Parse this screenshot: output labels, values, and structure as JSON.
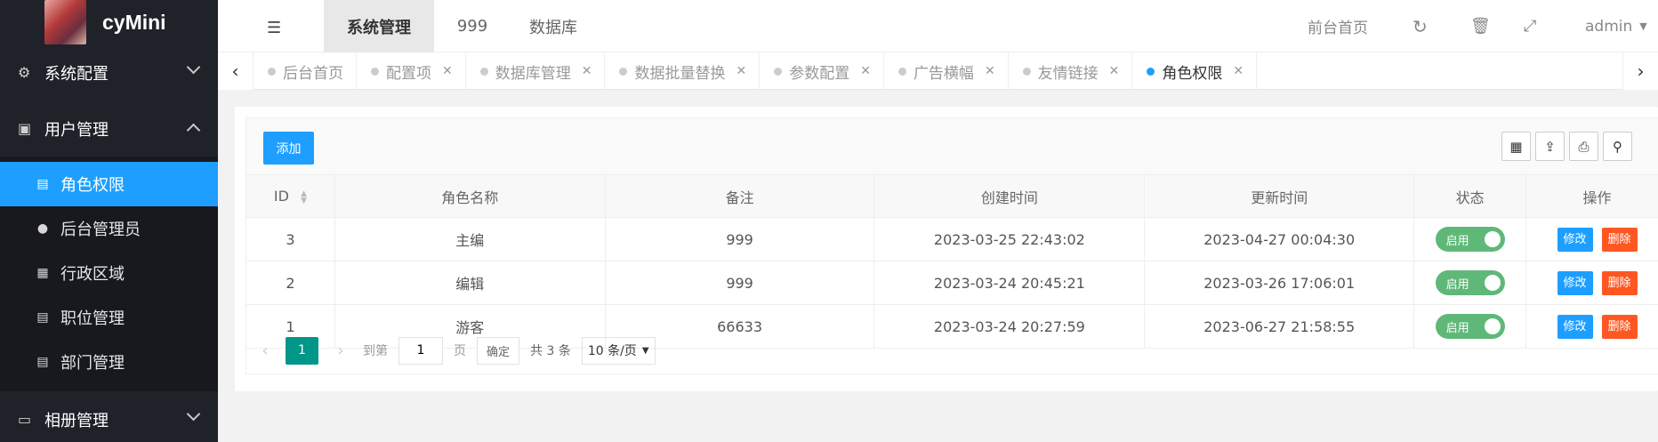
{
  "app": {
    "title": "cyMini"
  },
  "sidebar": {
    "groups": [
      {
        "label": "系统配置",
        "icon": "gears-icon",
        "expanded": false
      },
      {
        "label": "用户管理",
        "icon": "user-card-icon",
        "expanded": true
      },
      {
        "label": "相册管理",
        "icon": "folder-icon",
        "expanded": false
      }
    ],
    "user_items": [
      {
        "label": "角色权限",
        "icon": "id-card-icon",
        "active": true
      },
      {
        "label": "后台管理员",
        "icon": "users-icon",
        "active": false
      },
      {
        "label": "行政区域",
        "icon": "grid-icon",
        "active": false
      },
      {
        "label": "职位管理",
        "icon": "id-card-icon",
        "active": false
      },
      {
        "label": "部门管理",
        "icon": "id-card-icon",
        "active": false
      }
    ]
  },
  "header": {
    "menu_icon": "hamburger-icon",
    "tabs": [
      {
        "label": "系统管理",
        "active": true
      },
      {
        "label": "999",
        "active": false
      },
      {
        "label": "数据库",
        "active": false
      }
    ],
    "front_home": "前台首页",
    "user": "admin"
  },
  "page_tabs": [
    {
      "label": "后台首页",
      "closable": false,
      "active": false
    },
    {
      "label": "配置项",
      "closable": true,
      "active": false
    },
    {
      "label": "数据库管理",
      "closable": true,
      "active": false
    },
    {
      "label": "数据批量替换",
      "closable": true,
      "active": false
    },
    {
      "label": "参数配置",
      "closable": true,
      "active": false
    },
    {
      "label": "广告横幅",
      "closable": true,
      "active": false
    },
    {
      "label": "友情链接",
      "closable": true,
      "active": false
    },
    {
      "label": "角色权限",
      "closable": true,
      "active": true
    }
  ],
  "toolbar": {
    "add_label": "添加"
  },
  "table": {
    "columns": [
      "ID",
      "角色名称",
      "备注",
      "创建时间",
      "更新时间",
      "状态",
      "操作"
    ],
    "rows": [
      {
        "id": "3",
        "name": "主编",
        "remark": "999",
        "created": "2023-03-25 22:43:02",
        "updated": "2023-04-27 00:04:30",
        "status": "启用"
      },
      {
        "id": "2",
        "name": "编辑",
        "remark": "999",
        "created": "2023-03-24 20:45:21",
        "updated": "2023-03-26 17:06:01",
        "status": "启用"
      },
      {
        "id": "1",
        "name": "游客",
        "remark": "66633",
        "created": "2023-03-24 20:27:59",
        "updated": "2023-06-27 21:58:55",
        "status": "启用"
      }
    ],
    "edit_label": "修改",
    "delete_label": "删除"
  },
  "pager": {
    "current": "1",
    "goto_label": "到第",
    "goto_value": "1",
    "page_unit": "页",
    "confirm_label": "确定",
    "total_label": "共 3 条",
    "page_size": "10 条/页"
  },
  "colors": {
    "primary": "#1e9fff",
    "success": "#5fb878",
    "danger": "#ff5722",
    "pager": "#009688",
    "sidebar": "#20222a"
  }
}
